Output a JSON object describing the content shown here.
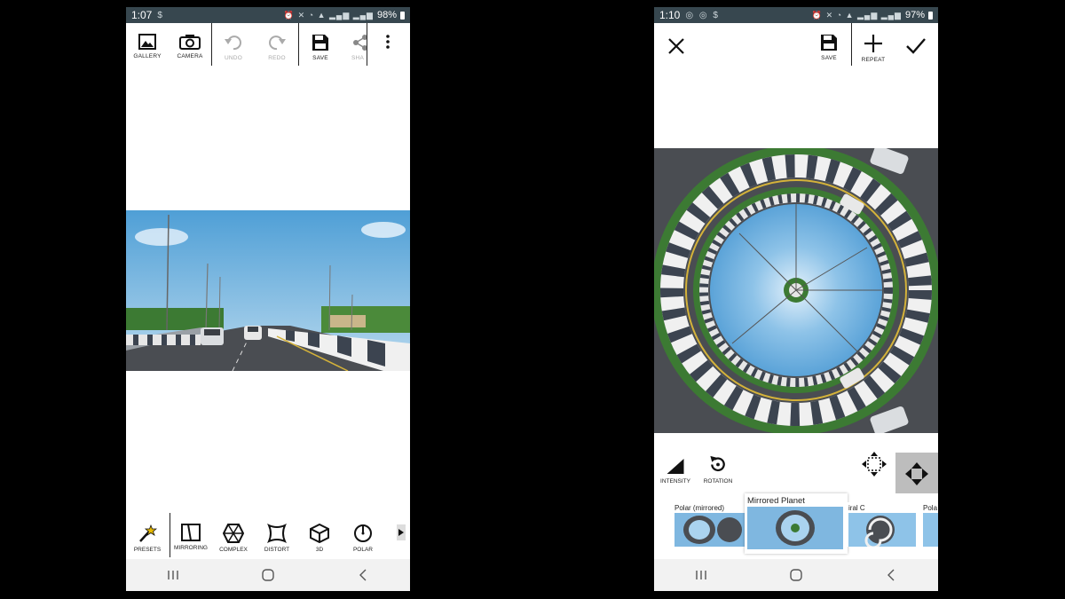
{
  "left_screen": {
    "status": {
      "time": "1:07",
      "battery": "98%"
    },
    "toolbar": {
      "gallery": "GALLERY",
      "camera": "CAMERA",
      "undo": "UNDO",
      "redo": "REDO",
      "save": "SAVE",
      "share": "SHA"
    },
    "bottom_tools": {
      "presets": "PRESETS",
      "mirroring": "MIRRORING",
      "complex": "COMPLEX",
      "distort": "DISTORT",
      "three_d": "3D",
      "polar": "POLAR"
    }
  },
  "right_screen": {
    "status": {
      "time": "1:10",
      "battery": "97%"
    },
    "toolbar": {
      "save": "SAVE",
      "repeat": "REPEAT"
    },
    "controls": {
      "intensity": "INTENSITY",
      "rotation": "ROTATION"
    },
    "presets": [
      {
        "name": "Polar (mirrored)"
      },
      {
        "name": "Mirrored Planet"
      },
      {
        "name": "iral C"
      },
      {
        "name": "Pola"
      }
    ]
  },
  "icons": {
    "gallery": "image-icon",
    "camera": "camera-icon",
    "undo": "undo-icon",
    "redo": "redo-icon",
    "save": "floppy-icon",
    "share": "share-icon",
    "more": "more-vert-icon",
    "close": "close-icon",
    "repeat": "plus-icon",
    "apply": "check-icon",
    "intensity": "intensity-icon",
    "rotation": "rotation-icon",
    "move": "move-arrows-icon",
    "fit": "fit-arrows-icon"
  },
  "colors": {
    "status_bar": "#37474f",
    "nav_bar": "#f2f2f2",
    "selected_tool_bg": "#bdbdbd",
    "disabled": "#aaaaaa"
  }
}
